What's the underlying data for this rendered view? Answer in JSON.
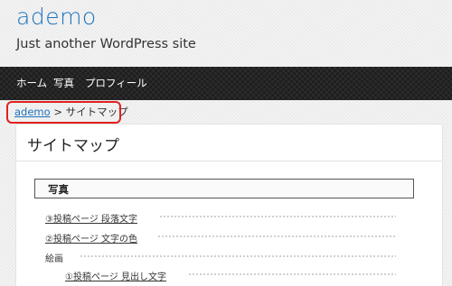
{
  "site": {
    "title": "ademo",
    "description": "Just another WordPress site"
  },
  "nav": {
    "items": [
      {
        "label": "ホーム"
      },
      {
        "label": "写真"
      },
      {
        "label": "プロフィール"
      }
    ]
  },
  "breadcrumb": {
    "home": "ademo",
    "separator": " > ",
    "current": "サイトマップ"
  },
  "page": {
    "title": "サイトマップ",
    "section": "写真",
    "items": [
      {
        "label": "③投稿ページ  段落文字"
      },
      {
        "label": "②投稿ページ  文字の色"
      },
      {
        "label": "絵画"
      },
      {
        "label": "①投稿ページ  見出し文字"
      }
    ]
  },
  "colors": {
    "accent": "#1e73be",
    "nav_background": "#1f1f1f",
    "highlight": "#e02020"
  }
}
